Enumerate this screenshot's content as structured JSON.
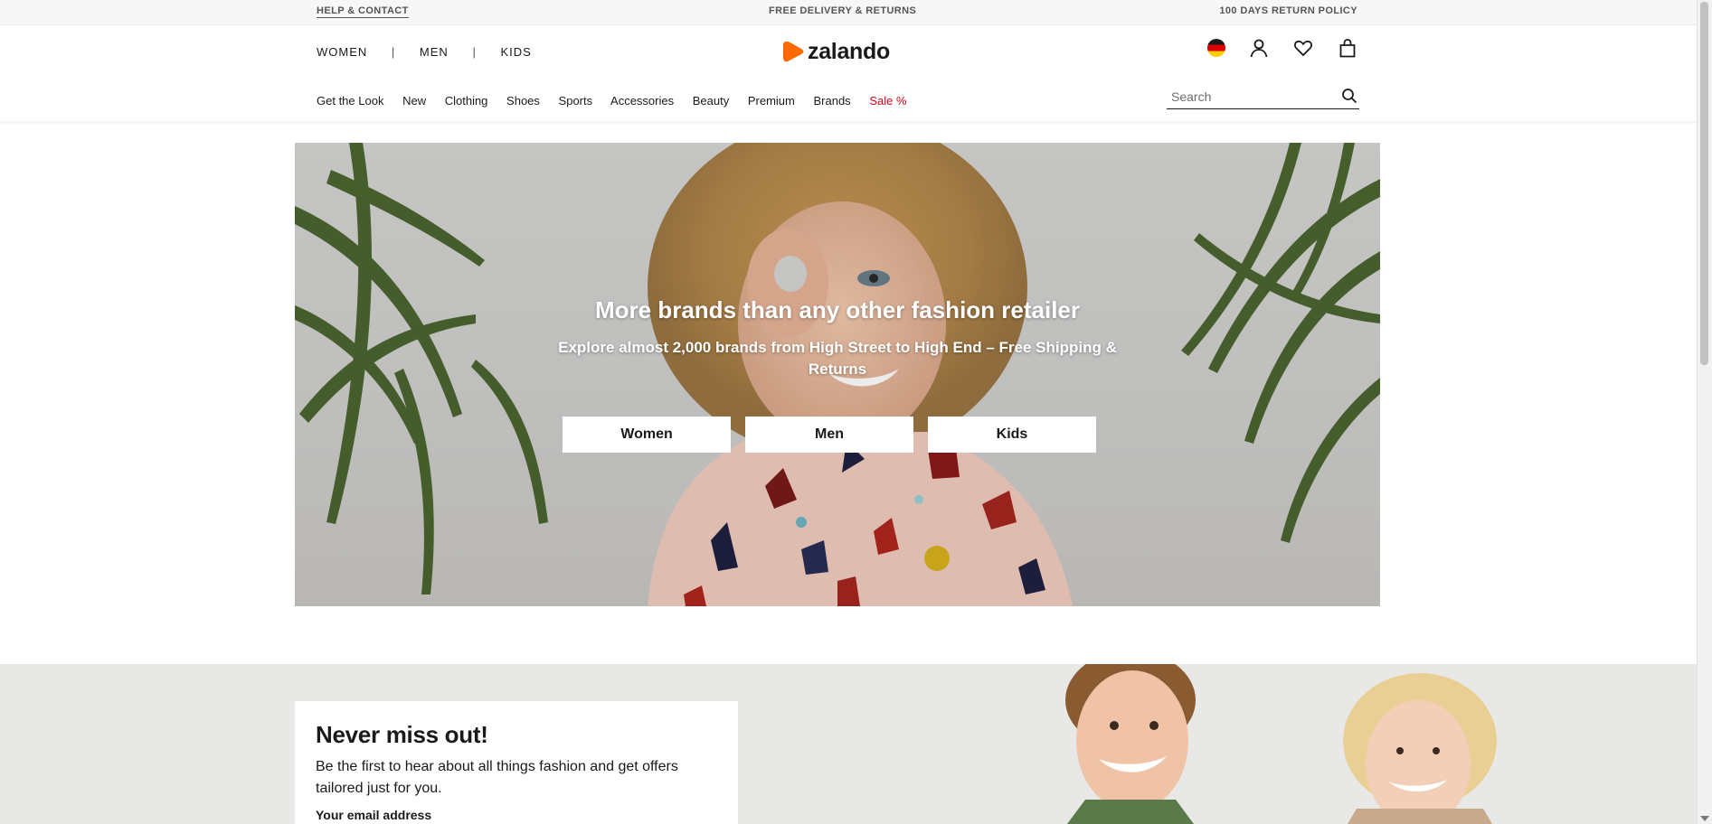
{
  "topbar": {
    "help": "HELP & CONTACT",
    "delivery": "FREE DELIVERY & RETURNS",
    "returns": "100 DAYS RETURN POLICY"
  },
  "gender_nav": [
    "WOMEN",
    "MEN",
    "KIDS"
  ],
  "gender_sep": "|",
  "logo": {
    "text": "zalando",
    "color": "#ff6900"
  },
  "header_icons": [
    "flag-germany-icon",
    "user-icon",
    "heart-icon",
    "shopping-bag-icon"
  ],
  "category_nav": [
    "Get the Look",
    "New",
    "Clothing",
    "Shoes",
    "Sports",
    "Accessories",
    "Beauty",
    "Premium",
    "Brands",
    "Sale %"
  ],
  "sale_color": "#d0021b",
  "search": {
    "placeholder": "Search"
  },
  "hero": {
    "title": "More brands than any other fashion retailer",
    "subtitle": "Explore almost 2,000 brands from High Street to High End – Free Shipping & Returns",
    "buttons": [
      "Women",
      "Men",
      "Kids"
    ]
  },
  "newsletter": {
    "title": "Never miss out!",
    "text": "Be the first to hear about all things fashion and get offers tailored just for you.",
    "email_label": "Your email address"
  }
}
